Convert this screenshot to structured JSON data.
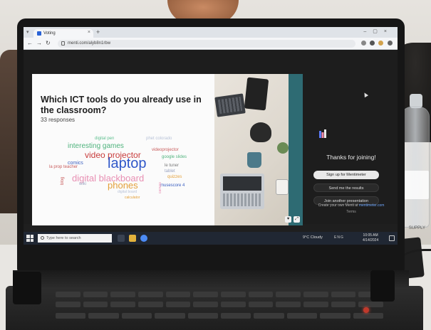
{
  "browser": {
    "tab_title": "Voting",
    "url": "menti.com/alyb8n1rbw",
    "new_tab": "+",
    "close": "×"
  },
  "slide": {
    "question": "Which ICT tools do you already use in the classroom?",
    "responses": "33 responses",
    "words": [
      {
        "text": "digital pen",
        "color": "#5fbf8f",
        "size": 6
      },
      {
        "text": "phet colorado",
        "color": "#b9c3d8",
        "size": 6
      },
      {
        "text": "interesting games",
        "color": "#4fb37d",
        "size": 10
      },
      {
        "text": "video projector",
        "color": "#c83c3c",
        "size": 12
      },
      {
        "text": "videoprojector",
        "color": "#c85c5c",
        "size": 6
      },
      {
        "text": "google slides",
        "color": "#4fb37d",
        "size": 6
      },
      {
        "text": "comics",
        "color": "#3b5fc0",
        "size": 7
      },
      {
        "text": "laptop",
        "color": "#2f57c9",
        "size": 20
      },
      {
        "text": "la prop teacher",
        "color": "#c85c5c",
        "size": 6
      },
      {
        "text": "le tuner",
        "color": "#7a7a7a",
        "size": 6
      },
      {
        "text": "tablet",
        "color": "#9aa4c0",
        "size": 6
      },
      {
        "text": "quizzes",
        "color": "#e3a03a",
        "size": 6
      },
      {
        "text": "digital blackboard",
        "color": "#e88fb3",
        "size": 13
      },
      {
        "text": "phones",
        "color": "#e3a03a",
        "size": 13
      },
      {
        "text": "musescore 4",
        "color": "#3b5fc0",
        "size": 6
      },
      {
        "text": "blog",
        "color": "#c85c5c",
        "size": 6
      },
      {
        "text": "wiki",
        "color": "#9aa4c0",
        "size": 6
      },
      {
        "text": "digital board",
        "color": "#b9c3d8",
        "size": 5
      },
      {
        "text": "calculator",
        "color": "#e3a03a",
        "size": 5
      },
      {
        "text": "canvas",
        "color": "#e88fb3",
        "size": 5
      }
    ]
  },
  "panel": {
    "thanks": "Thanks for joining!",
    "signup_button": "Sign up for Mentimeter",
    "results_button": "Send me the results",
    "join_button": "Join another presentation",
    "footer_prefix": "Create your own Menti at",
    "footer_link": "mentimeter.com",
    "terms": "Terms"
  },
  "taskbar": {
    "search_placeholder": "Type here to search",
    "weather": "9°C Cloudy",
    "tray": "ENG",
    "time": "10:05 AM",
    "date": "4/14/2024"
  },
  "bottle_text": "SUPPLY",
  "colors": {
    "brand": "#5b7cfa",
    "screen_bg": "#1d1d1d",
    "taskbar": "#202733"
  }
}
